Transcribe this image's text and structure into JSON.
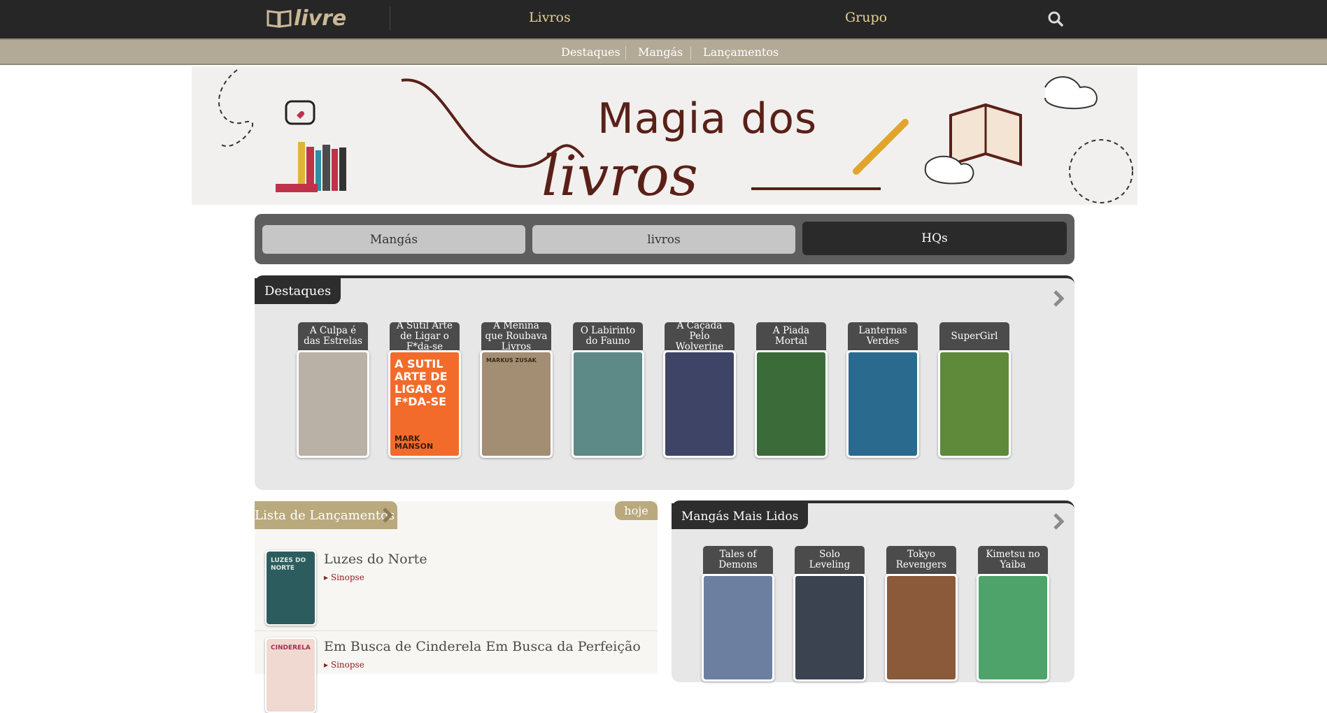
{
  "header": {
    "logo_text": "livre",
    "nav": [
      "Livros",
      "Grupo"
    ],
    "search_icon": "search-icon"
  },
  "subnav": [
    "Destaques",
    "Mangás",
    "Lançamentos"
  ],
  "banner": {
    "title": "Magia dos",
    "script": "livros"
  },
  "tabs": [
    {
      "label": "Mangás",
      "active": false
    },
    {
      "label": "livros",
      "active": false
    },
    {
      "label": "HQs",
      "active": true
    }
  ],
  "destaques": {
    "title": "Destaques",
    "books": [
      {
        "label": "A Culpa é das Estrelas",
        "cover_color": "#b9b1a6"
      },
      {
        "label": "A Sutil Arte de Ligar o F*da-se",
        "cover_color": "#f26b2a",
        "cover_text": "A SUTIL ARTE DE LIGAR O F*DA-SE",
        "cover_author": "MARK MANSON"
      },
      {
        "label": "A Menina que Roubava Livros",
        "cover_color": "#a38e73",
        "cover_author": "MARKUS ZUSAK"
      },
      {
        "label": "O Labirinto do Fauno",
        "cover_color": "#5d8a86"
      },
      {
        "label": "A Caçada Pelo Wolverine",
        "cover_color": "#3e4466"
      },
      {
        "label": "A Piada Mortal",
        "cover_color": "#3c6b3a"
      },
      {
        "label": "Lanternas Verdes",
        "cover_color": "#2b6a8f"
      },
      {
        "label": "SuperGirl",
        "cover_color": "#5e8a3a"
      }
    ]
  },
  "lancamentos": {
    "title": "Lista de Lançamentos",
    "badge": "hoje",
    "items": [
      {
        "title": "Luzes do Norte",
        "sinopse": "Sinopse",
        "cover_color": "#2d5c5e"
      },
      {
        "title": "Em Busca de Cinderela Em Busca da Perfeição",
        "sinopse": "Sinopse",
        "cover_color": "#f0d9d0"
      }
    ]
  },
  "mangas": {
    "title": "Mangás Mais Lidos",
    "books": [
      {
        "label": "Tales of Demons",
        "cover_color": "#6c7fa0"
      },
      {
        "label": "Solo Leveling",
        "cover_color": "#3b4250"
      },
      {
        "label": "Tokyo Revengers",
        "cover_color": "#8a5a3a"
      },
      {
        "label": "Kimetsu no Yaiba",
        "cover_color": "#4ea36a"
      }
    ]
  },
  "colors": {
    "topbar": "#262626",
    "gold": "#e6cf98",
    "subbar": "#b3a997",
    "accent": "#b9a97d"
  }
}
